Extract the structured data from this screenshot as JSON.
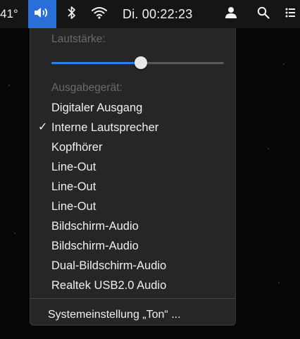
{
  "menubar": {
    "temperature": "41°",
    "clock": "Di. 00:22:23",
    "icons": {
      "volume": "volume-icon",
      "bluetooth": "bluetooth-icon",
      "wifi": "wifi-icon",
      "user": "user-icon",
      "search": "search-icon",
      "list": "list-icon"
    },
    "active_color": "#2a6fd8"
  },
  "volume_menu": {
    "volume_label": "Lautstärke:",
    "volume_level": 0.52,
    "output_label": "Ausgabegerät:",
    "devices": [
      {
        "label": "Digitaler Ausgang",
        "selected": false
      },
      {
        "label": "Interne Lautsprecher",
        "selected": true
      },
      {
        "label": "Kopfhörer",
        "selected": false
      },
      {
        "label": "Line-Out",
        "selected": false
      },
      {
        "label": "Line-Out",
        "selected": false
      },
      {
        "label": "Line-Out",
        "selected": false
      },
      {
        "label": "Bildschirm-Audio",
        "selected": false
      },
      {
        "label": "Bildschirm-Audio",
        "selected": false
      },
      {
        "label": "Dual-Bildschirm-Audio",
        "selected": false
      },
      {
        "label": "Realtek USB2.0 Audio",
        "selected": false
      }
    ],
    "check_mark": "✓",
    "settings_label": "Systemeinstellung „Ton“ ..."
  }
}
